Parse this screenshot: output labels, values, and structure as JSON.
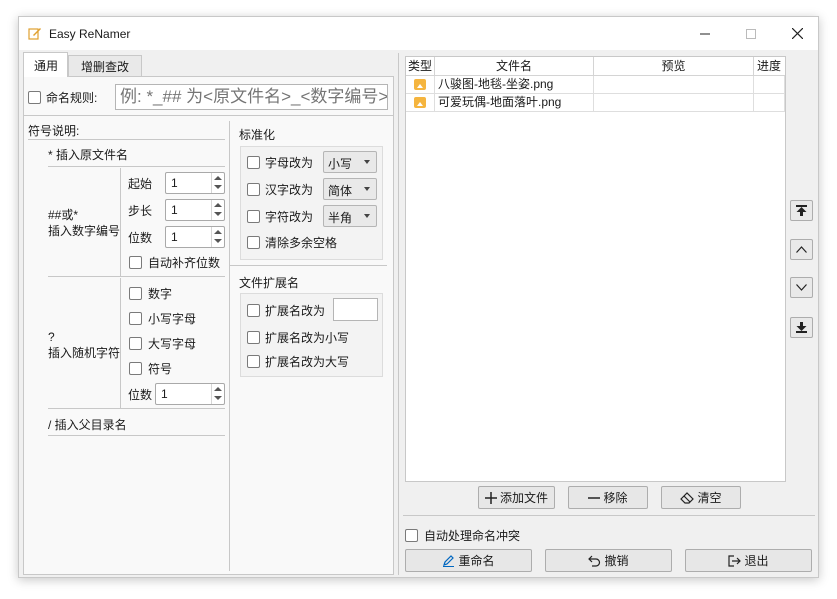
{
  "window": {
    "title": "Easy ReNamer"
  },
  "tabs": [
    "通用",
    "增删查改"
  ],
  "naming_rule": {
    "label": "命名规则:",
    "placeholder": "例: *_## 为<原文件名>_<数字编号>"
  },
  "symbols": {
    "header": "符号说明:",
    "original_name": "* 插入原文件名",
    "number_label_1": "##或*",
    "number_label_2": "插入数字编号",
    "start_label": "起始",
    "start_value": "1",
    "step_label": "步长",
    "step_value": "1",
    "digits_label": "位数",
    "digits_value": "1",
    "auto_pad": "自动补齐位数",
    "random_label_1": "?",
    "random_label_2": "插入随机字符",
    "random_options": [
      "数字",
      "小写字母",
      "大写字母",
      "符号"
    ],
    "random_digits_label": "位数",
    "random_digits_value": "1",
    "parent_dir": "/ 插入父目录名"
  },
  "standardize": {
    "header": "标准化",
    "letters": {
      "label": "字母改为",
      "value": "小写"
    },
    "chinese": {
      "label": "汉字改为",
      "value": "简体"
    },
    "chars": {
      "label": "字符改为",
      "value": "半角"
    },
    "spaces": "清除多余空格"
  },
  "extension": {
    "header": "文件扩展名",
    "change_to": "扩展名改为",
    "lower": "扩展名改为小写",
    "upper": "扩展名改为大写"
  },
  "table": {
    "headers": [
      "类型",
      "文件名",
      "预览",
      "进度"
    ],
    "rows": [
      {
        "type_icon": "image-file-icon",
        "filename": "八骏图-地毯-坐姿.png"
      },
      {
        "type_icon": "image-file-icon",
        "filename": "可爱玩偶-地面落叶.png"
      }
    ]
  },
  "list_buttons": {
    "add": "添加文件",
    "remove": "移除",
    "clear": "清空"
  },
  "auto_conflict": "自动处理命名冲突",
  "actions": {
    "rename": "重命名",
    "undo": "撤销",
    "exit": "退出"
  },
  "colors": {
    "file_icon": "#f5b53f",
    "accent": "#0067c0"
  }
}
